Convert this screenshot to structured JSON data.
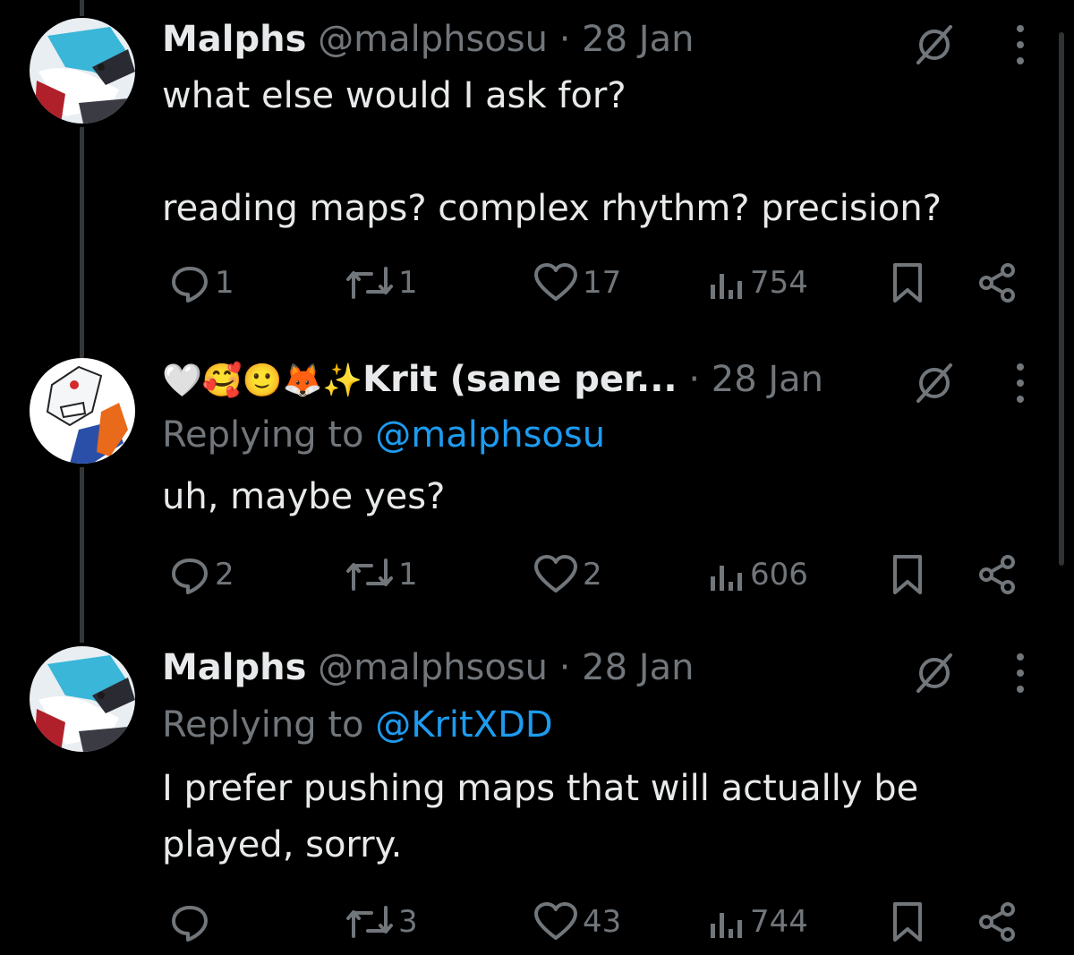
{
  "colors": {
    "background": "#000000",
    "text": "#e7e9ea",
    "muted": "#71767b",
    "link": "#1d9bf0"
  },
  "tweets": [
    {
      "display_name": "Malphs",
      "handle": "@malphsosu",
      "separator": "·",
      "date": "28 Jan",
      "replying_label": "",
      "replying_to": "",
      "text": "what else would I ask for?\n\nreading maps? complex rhythm? precision?",
      "stats": {
        "replies": "1",
        "reposts": "1",
        "likes": "17",
        "views": "754"
      }
    },
    {
      "display_name_emojis": "🤍🥰🙂🦊✨",
      "display_name": "Krit (sane per...",
      "handle": "",
      "separator": "·",
      "date": "28 Jan",
      "replying_label": "Replying to",
      "replying_to": "@malphsosu",
      "text": "uh, maybe yes?",
      "stats": {
        "replies": "2",
        "reposts": "1",
        "likes": "2",
        "views": "606"
      }
    },
    {
      "display_name": "Malphs",
      "handle": "@malphsosu",
      "separator": "·",
      "date": "28 Jan",
      "replying_label": "Replying to",
      "replying_to": "@KritXDD",
      "text": "I prefer pushing maps that will actually be\nplayed, sorry.",
      "stats": {
        "replies": "",
        "reposts": "3",
        "likes": "43",
        "views": "744"
      }
    }
  ],
  "icons": [
    "reply-icon",
    "repost-icon",
    "like-icon",
    "views-icon",
    "bookmark-icon",
    "share-icon",
    "mute-icon",
    "more-icon"
  ]
}
